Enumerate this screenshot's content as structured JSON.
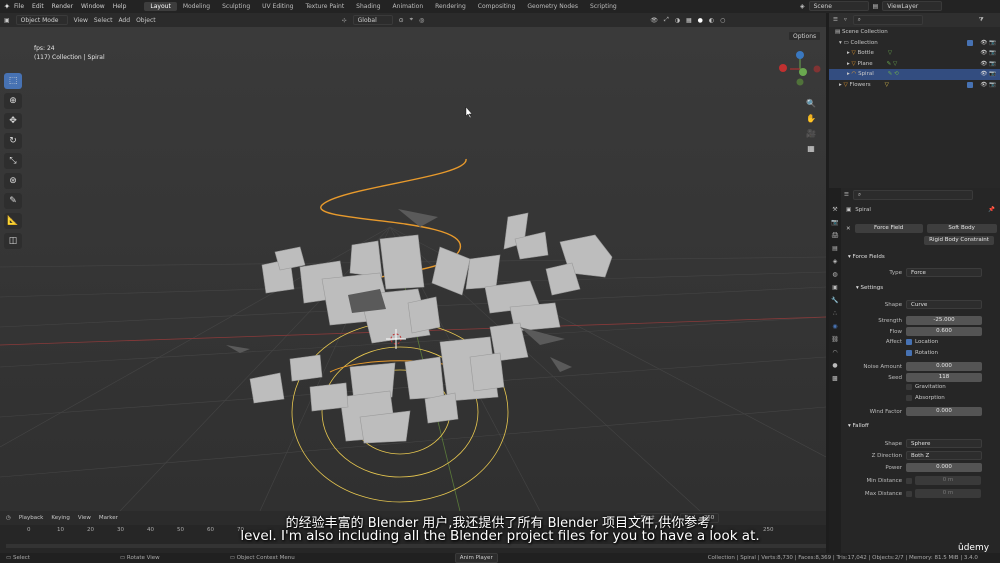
{
  "menubar": {
    "items": [
      "File",
      "Edit",
      "Render",
      "Window",
      "Help"
    ]
  },
  "workspaces": [
    "Layout",
    "Modeling",
    "Sculpting",
    "UV Editing",
    "Texture Paint",
    "Shading",
    "Animation",
    "Rendering",
    "Compositing",
    "Geometry Nodes",
    "Scripting"
  ],
  "active_workspace": "Layout",
  "scene": {
    "name": "Scene",
    "view_layer": "ViewLayer"
  },
  "viewport_header": {
    "mode": "Object Mode",
    "menus": [
      "View",
      "Select",
      "Add",
      "Object"
    ],
    "orientation": "Global",
    "options": "Options"
  },
  "viewport_info": {
    "fps": "fps: 24",
    "collection": "(117) Collection | Spiral"
  },
  "outliner": {
    "rows": [
      {
        "label": "Scene Collection",
        "indent": 0,
        "selected": false
      },
      {
        "label": "Collection",
        "indent": 1,
        "selected": false
      },
      {
        "label": "Bottle",
        "indent": 2,
        "selected": false
      },
      {
        "label": "Plane",
        "indent": 2,
        "selected": false
      },
      {
        "label": "Spiral",
        "indent": 2,
        "selected": true
      },
      {
        "label": "Flowers",
        "indent": 1,
        "selected": false
      }
    ]
  },
  "properties": {
    "object_name": "Spiral",
    "buttons": {
      "force_field": "Force Field",
      "soft_body": "Soft Body",
      "rigid_body_constraint": "Rigid Body Constraint"
    },
    "sections": {
      "force_fields": "Force Fields",
      "settings": "Settings",
      "falloff": "Falloff"
    },
    "type": {
      "label": "Type",
      "value": "Force"
    },
    "shape": {
      "label": "Shape",
      "value": "Curve"
    },
    "strength": {
      "label": "Strength",
      "value": "-25.000"
    },
    "flow": {
      "label": "Flow",
      "value": "0.600"
    },
    "affect": {
      "label": "Affect",
      "location": "Location",
      "rotation": "Rotation"
    },
    "noise_amount": {
      "label": "Noise Amount",
      "value": "0.000"
    },
    "seed": {
      "label": "Seed",
      "value": "118"
    },
    "gravitation": "Gravitation",
    "absorption": "Absorption",
    "wind_factor": {
      "label": "Wind Factor",
      "value": "0.000"
    },
    "falloff_shape": {
      "label": "Shape",
      "value": "Sphere"
    },
    "z_direction": {
      "label": "Z Direction",
      "value": "Both Z"
    },
    "power": {
      "label": "Power",
      "value": "0.000"
    },
    "min_distance": {
      "label": "Min Distance",
      "value": "0 m"
    },
    "max_distance": {
      "label": "Max Distance",
      "value": "0 m"
    }
  },
  "timeline": {
    "menus": [
      "Playback",
      "Keying",
      "View",
      "Marker"
    ],
    "start_label": "Start",
    "start": "1",
    "end_label": "End",
    "end": "250",
    "ruler": [
      "0",
      "10",
      "20",
      "30",
      "40",
      "50",
      "60",
      "70",
      "250"
    ]
  },
  "statusbar": {
    "select": "Select",
    "rotate": "Rotate View",
    "context": "Object Context Menu",
    "anim": "Anim Player",
    "stats": "Collection | Spiral | Verts:8,730 | Faces:8,369 | Tris:17,042 | Objects:2/7 | Memory: 81.5 MiB | 3.4.0"
  },
  "subtitles": {
    "line1": "的经验丰富的 Blender 用户,我还提供了所有 Blender 项目文件,供你参考,",
    "line2": "level. I'm also including all the Blender project files for you to have a look at."
  },
  "watermark": "ûdemy",
  "colors": {
    "accent": "#4772b3",
    "selected": "#334d80",
    "curve": "#e89a2c",
    "empty": "#e8c850"
  }
}
